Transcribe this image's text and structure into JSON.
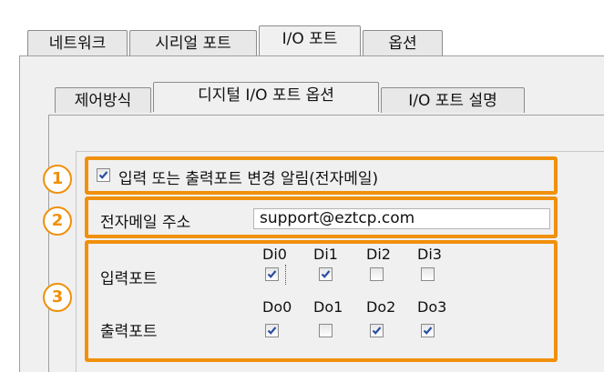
{
  "tabs_outer": [
    {
      "label": "네트워크"
    },
    {
      "label": "시리얼 포트"
    },
    {
      "label": "I/O 포트",
      "active": true
    },
    {
      "label": "옵션"
    }
  ],
  "tabs_inner": [
    {
      "label": "제어방식"
    },
    {
      "label": "디지털 I/O 포트 옵션",
      "active": true
    },
    {
      "label": "I/O 포트 설명"
    }
  ],
  "notify": {
    "label": "입력 또는 출력포트 변경 알림(전자메일)",
    "checked": true
  },
  "email": {
    "label": "전자메일 주소",
    "value": "support@eztcp.com"
  },
  "ports": {
    "input_label": "입력포트",
    "output_label": "출력포트",
    "inputs": [
      {
        "name": "Di0",
        "checked": true
      },
      {
        "name": "Di1",
        "checked": true
      },
      {
        "name": "Di2",
        "checked": false
      },
      {
        "name": "Di3",
        "checked": false
      }
    ],
    "outputs": [
      {
        "name": "Do0",
        "checked": true
      },
      {
        "name": "Do1",
        "checked": false
      },
      {
        "name": "Do2",
        "checked": true
      },
      {
        "name": "Do3",
        "checked": true
      }
    ]
  },
  "annotations": {
    "n1": "1",
    "n2": "2",
    "n3": "3",
    "color": "#f0900b"
  }
}
